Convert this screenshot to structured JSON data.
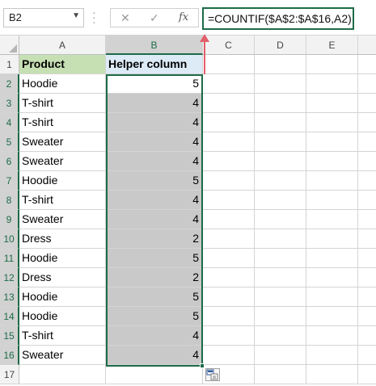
{
  "formula_bar": {
    "name_box": "B2",
    "cancel_icon": "✕",
    "enter_icon": "✓",
    "fx_label": "fx",
    "formula": "=COUNTIF($A$2:$A$16,A2)"
  },
  "columns": [
    "A",
    "B",
    "C",
    "D",
    "E"
  ],
  "rows": [
    "1",
    "2",
    "3",
    "4",
    "5",
    "6",
    "7",
    "8",
    "9",
    "10",
    "11",
    "12",
    "13",
    "14",
    "15",
    "16",
    "17"
  ],
  "header": {
    "a": "Product",
    "b": "Helper column"
  },
  "data": [
    {
      "product": "Hoodie",
      "count": "5"
    },
    {
      "product": "T-shirt",
      "count": "4"
    },
    {
      "product": "T-shirt",
      "count": "4"
    },
    {
      "product": "Sweater",
      "count": "4"
    },
    {
      "product": "Sweater",
      "count": "4"
    },
    {
      "product": "Hoodie",
      "count": "5"
    },
    {
      "product": "T-shirt",
      "count": "4"
    },
    {
      "product": "Sweater",
      "count": "4"
    },
    {
      "product": "Dress",
      "count": "2"
    },
    {
      "product": "Hoodie",
      "count": "5"
    },
    {
      "product": "Dress",
      "count": "2"
    },
    {
      "product": "Hoodie",
      "count": "5"
    },
    {
      "product": "Hoodie",
      "count": "5"
    },
    {
      "product": "T-shirt",
      "count": "4"
    },
    {
      "product": "Sweater",
      "count": "4"
    }
  ],
  "colors": {
    "selection": "#1d6b47",
    "header_a_fill": "#c6e0b4",
    "header_b_fill": "#ddebf7",
    "selected_fill": "#c9c9c9",
    "arrow": "#e0606b"
  }
}
